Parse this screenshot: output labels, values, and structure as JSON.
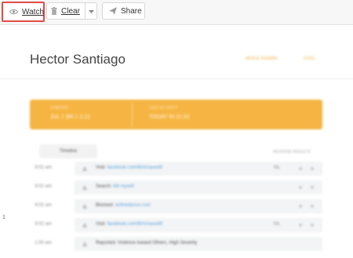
{
  "toolbar": {
    "watch_label": "Watch",
    "clear_label": "Clear",
    "share_label": "Share",
    "highlight_color": "#e24b45"
  },
  "profile": {
    "name": "Hector Santiago",
    "header_links": [
      "MERGE REMARK",
      "EDGE"
    ]
  },
  "banner": {
    "color": "#f6b542",
    "left_label": "STARTED",
    "left_value": "JUL 1  BR 1  2:21",
    "right_label": "LAST ACTIVITY",
    "right_value": "TODAY  IN  21:52"
  },
  "activity": {
    "tab_label": "Timeline",
    "right_label": "REVERSE RESULTS",
    "rows": [
      {
        "time": "9:02 am",
        "prefix": "Visit:",
        "link": "facebook.com/B/m/savedif",
        "tag": "TBL"
      },
      {
        "time": "9:02 am",
        "prefix": "Search:",
        "link": "bill myself",
        "tag": ""
      },
      {
        "time": "9:02 am",
        "prefix": "Blocked:",
        "link": "onlinedance.com",
        "tag": ""
      },
      {
        "time": "9:02 am",
        "prefix": "Visit:",
        "link": "facebook.com/B/m/savedif",
        "tag": "TBL"
      },
      {
        "time": "1:00 am",
        "prefix": "Reported: Violence toward Others, High Severity",
        "link": "",
        "tag": ""
      }
    ],
    "page_marker": "1"
  }
}
